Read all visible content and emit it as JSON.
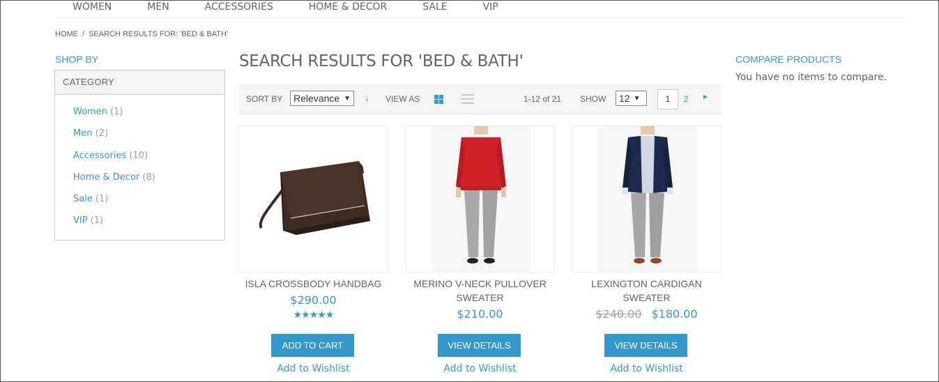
{
  "topnav": [
    "WOMEN",
    "MEN",
    "ACCESSORIES",
    "HOME & DECOR",
    "SALE",
    "VIP"
  ],
  "breadcrumb": {
    "home": "HOME",
    "sep": "/",
    "current": "SEARCH RESULTS FOR: 'BED & BATH'"
  },
  "sidebar": {
    "shop_by": "SHOP BY",
    "category_header": "CATEGORY",
    "categories": [
      {
        "label": "Women",
        "count": "(1)"
      },
      {
        "label": "Men",
        "count": "(2)"
      },
      {
        "label": "Accessories",
        "count": "(10)"
      },
      {
        "label": "Home & Decor",
        "count": "(8)"
      },
      {
        "label": "Sale",
        "count": "(1)"
      },
      {
        "label": "VIP",
        "count": "(1)"
      }
    ]
  },
  "main": {
    "title": "SEARCH RESULTS FOR 'BED & BATH'",
    "toolbar": {
      "sort_label": "SORT BY",
      "sort_value": "Relevance",
      "view_label": "VIEW AS",
      "count": "1-12 of 21",
      "show_label": "SHOW",
      "show_value": "12",
      "page_current": "1",
      "page_next_num": "2"
    },
    "products": [
      {
        "name": "ISLA CROSSBODY HANDBAG",
        "price": "$290.00",
        "old_price": "",
        "rating": "★★★★★",
        "button": "ADD TO CART",
        "wishlist": "Add to Wishlist"
      },
      {
        "name": "MERINO V-NECK PULLOVER SWEATER",
        "price": "$210.00",
        "old_price": "",
        "button": "VIEW DETAILS",
        "wishlist": "Add to Wishlist"
      },
      {
        "name": "LEXINGTON CARDIGAN SWEATER",
        "price": "$180.00",
        "old_price": "$240.00",
        "button": "VIEW DETAILS",
        "wishlist": "Add to Wishlist"
      }
    ]
  },
  "compare": {
    "title": "COMPARE PRODUCTS",
    "text": "You have no items to compare."
  },
  "colors": {
    "accent": "#3399cc",
    "text": "#636363",
    "muted": "#a0a0a0",
    "toolbar_bg": "#f4f4f4"
  }
}
